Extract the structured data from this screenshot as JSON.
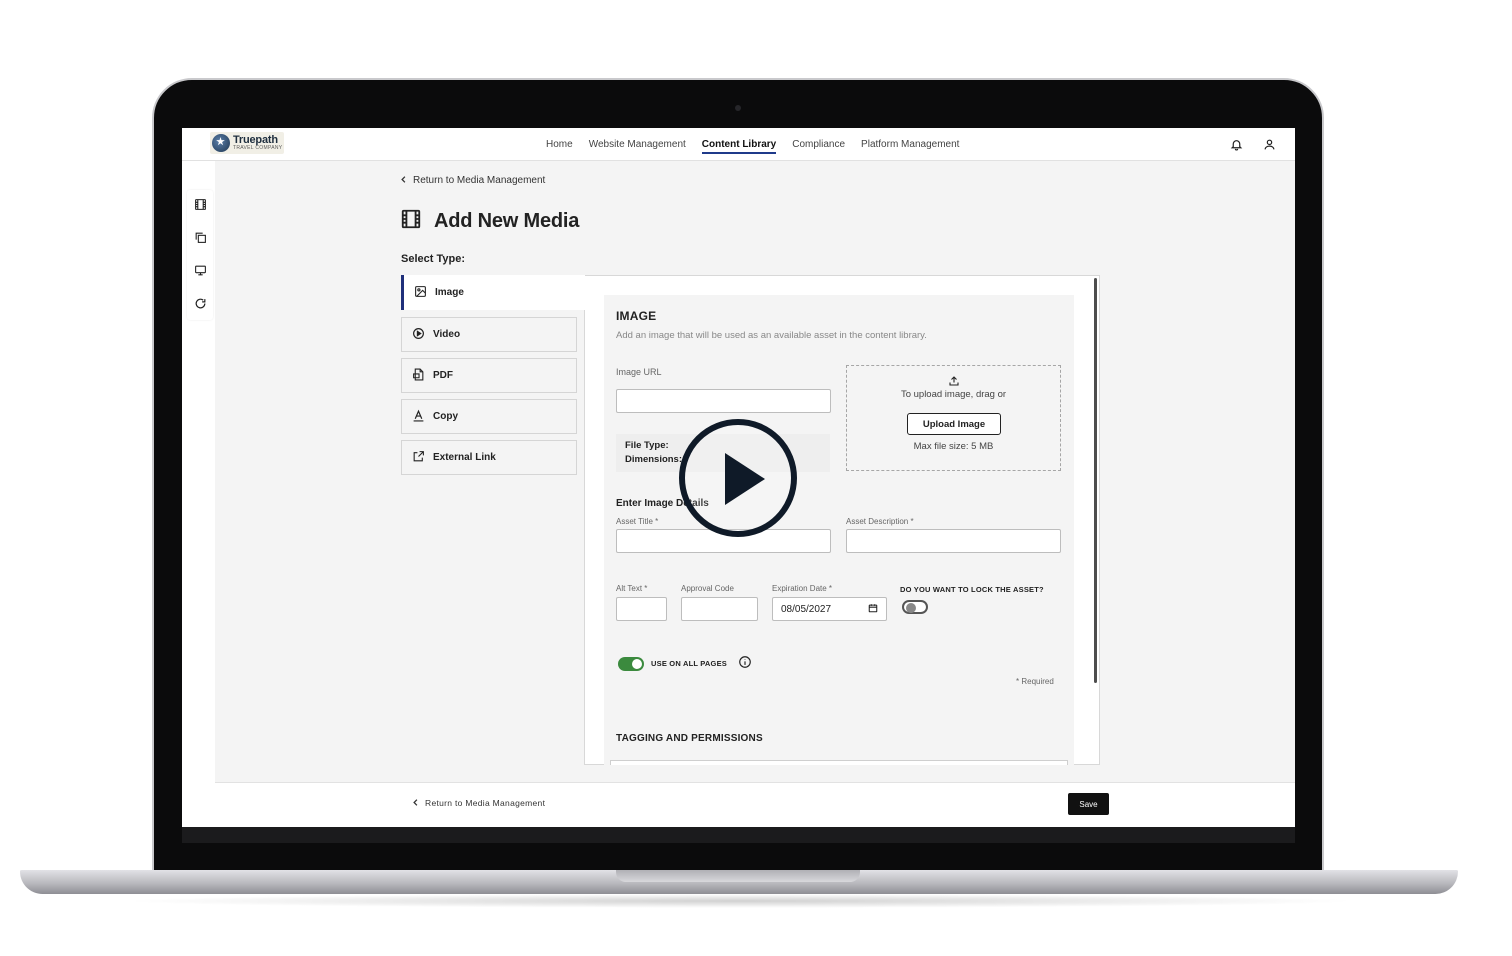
{
  "brand": {
    "name": "Truepath",
    "tagline": "TRAVEL COMPANY"
  },
  "nav": {
    "links": [
      {
        "label": "Home"
      },
      {
        "label": "Website Management"
      },
      {
        "label": "Content Library"
      },
      {
        "label": "Compliance"
      },
      {
        "label": "Platform Management"
      }
    ],
    "active_index": 2
  },
  "page": {
    "back_label": "Return to Media Management",
    "title": "Add New Media",
    "select_type_label": "Select Type:"
  },
  "types": [
    {
      "label": "Image",
      "icon": "image-icon"
    },
    {
      "label": "Video",
      "icon": "play-circle-icon"
    },
    {
      "label": "PDF",
      "icon": "pdf-icon"
    },
    {
      "label": "Copy",
      "icon": "text-icon"
    },
    {
      "label": "External Link",
      "icon": "external-link-icon"
    }
  ],
  "form": {
    "section_title": "IMAGE",
    "section_desc": "Add an image that will be used as an available asset in the content library.",
    "image_url_label": "Image URL",
    "image_url_value": "",
    "upload_prompt": "To upload image, drag or",
    "upload_button": "Upload Image",
    "max_size": "Max file size: 5 MB",
    "file_type_label": "File Type:",
    "dimensions_label": "Dimensions:",
    "details_title": "Enter Image Details",
    "asset_title_label": "Asset Title *",
    "asset_title_value": "",
    "asset_desc_label": "Asset Description *",
    "asset_desc_value": "",
    "alt_text_label": "Alt Text *",
    "approval_code_label": "Approval Code",
    "expiration_label": "Expiration Date *",
    "expiration_value": "08/05/2027",
    "lock_label": "DO YOU WANT TO LOCK THE ASSET?",
    "lock_on": false,
    "use_all_pages_label": "USE ON ALL PAGES",
    "use_all_pages_on": true,
    "required_note": "* Required",
    "tagging_title": "TAGGING AND PERMISSIONS"
  },
  "footer": {
    "back_label": "Return to Media Management",
    "save_label": "Save"
  },
  "colors": {
    "accent": "#1f3a8a",
    "toggle_on": "#3b8a3e",
    "primary_button": "#111111"
  }
}
